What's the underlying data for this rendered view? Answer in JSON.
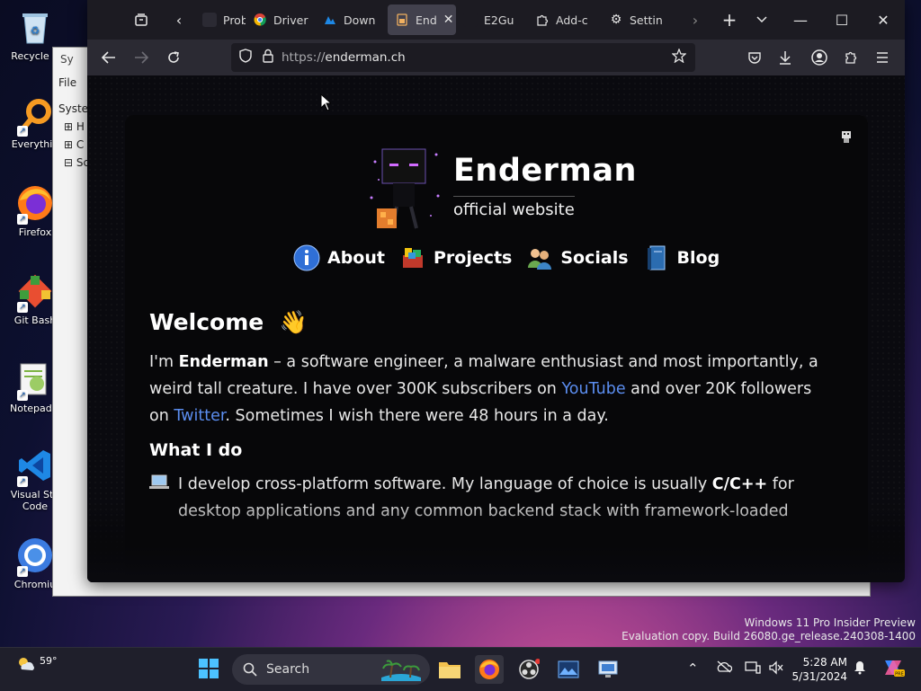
{
  "desktop": {
    "icons": [
      {
        "label": "Recycle Bin",
        "display": "Recycle B"
      },
      {
        "label": "Everything",
        "display": "Everythin"
      },
      {
        "label": "Firefox",
        "display": "Firefox"
      },
      {
        "label": "Git Bash",
        "display": "Git Bash"
      },
      {
        "label": "Notepad++",
        "display": "Notepad+"
      },
      {
        "label": "Visual Studio Code",
        "display": "Visual Stu Code"
      },
      {
        "label": "Chromium",
        "display": "Chromiu"
      }
    ]
  },
  "background_window": {
    "title": "Sy",
    "menu": "File",
    "tree": [
      "Syste",
      "H",
      "C",
      "Sc"
    ]
  },
  "browser": {
    "tabs": [
      {
        "label": "Probl",
        "icon": "page-icon"
      },
      {
        "label": "Driver",
        "icon": "chrome-icon"
      },
      {
        "label": "Down",
        "icon": "download-icon"
      },
      {
        "label": "End",
        "icon": "lock-page-icon",
        "active": true
      },
      {
        "label": "E2Gu",
        "icon": "e2-icon"
      },
      {
        "label": "Add-c",
        "icon": "puzzle-icon"
      },
      {
        "label": "Settin",
        "icon": "gear-icon"
      }
    ],
    "url_prefix": "https://",
    "url_domain": "enderman.ch"
  },
  "page": {
    "site_title": "Enderman",
    "site_subtitle": "official website",
    "nav": [
      {
        "label": "About",
        "icon": "info-icon"
      },
      {
        "label": "Projects",
        "icon": "projects-icon"
      },
      {
        "label": "Socials",
        "icon": "people-icon"
      },
      {
        "label": "Blog",
        "icon": "book-icon"
      }
    ],
    "welcome_heading": "Welcome",
    "welcome_emoji": "👋",
    "intro": {
      "p1": "I'm ",
      "name": "Enderman",
      "p2": " – a software engineer, a malware enthusiast and most importantly, a weird tall creature. I have over 300K subscribers on ",
      "youtube": "YouTube",
      "p3": " and over 20K followers on ",
      "twitter": "Twitter",
      "p4": ". Sometimes I wish there were 48 hours in a day."
    },
    "what_heading": "What I do",
    "item1": {
      "p1": "I develop cross-platform software. My language of choice is usually ",
      "lang": "C/C++",
      "p2": " for desktop applications and any common backend stack with framework-loaded"
    }
  },
  "watermark": {
    "line1": "Windows 11 Pro Insider Preview",
    "line2": "Evaluation copy. Build 26080.ge_release.240308-1400"
  },
  "taskbar": {
    "weather_temp": "59°",
    "search_placeholder": "Search",
    "time": "5:28 AM",
    "date": "5/31/2024"
  },
  "colors": {
    "link": "#5b8def",
    "browser_frame": "#1c1b22",
    "toolbar": "#2b2a33",
    "page_bg": "#070709"
  }
}
